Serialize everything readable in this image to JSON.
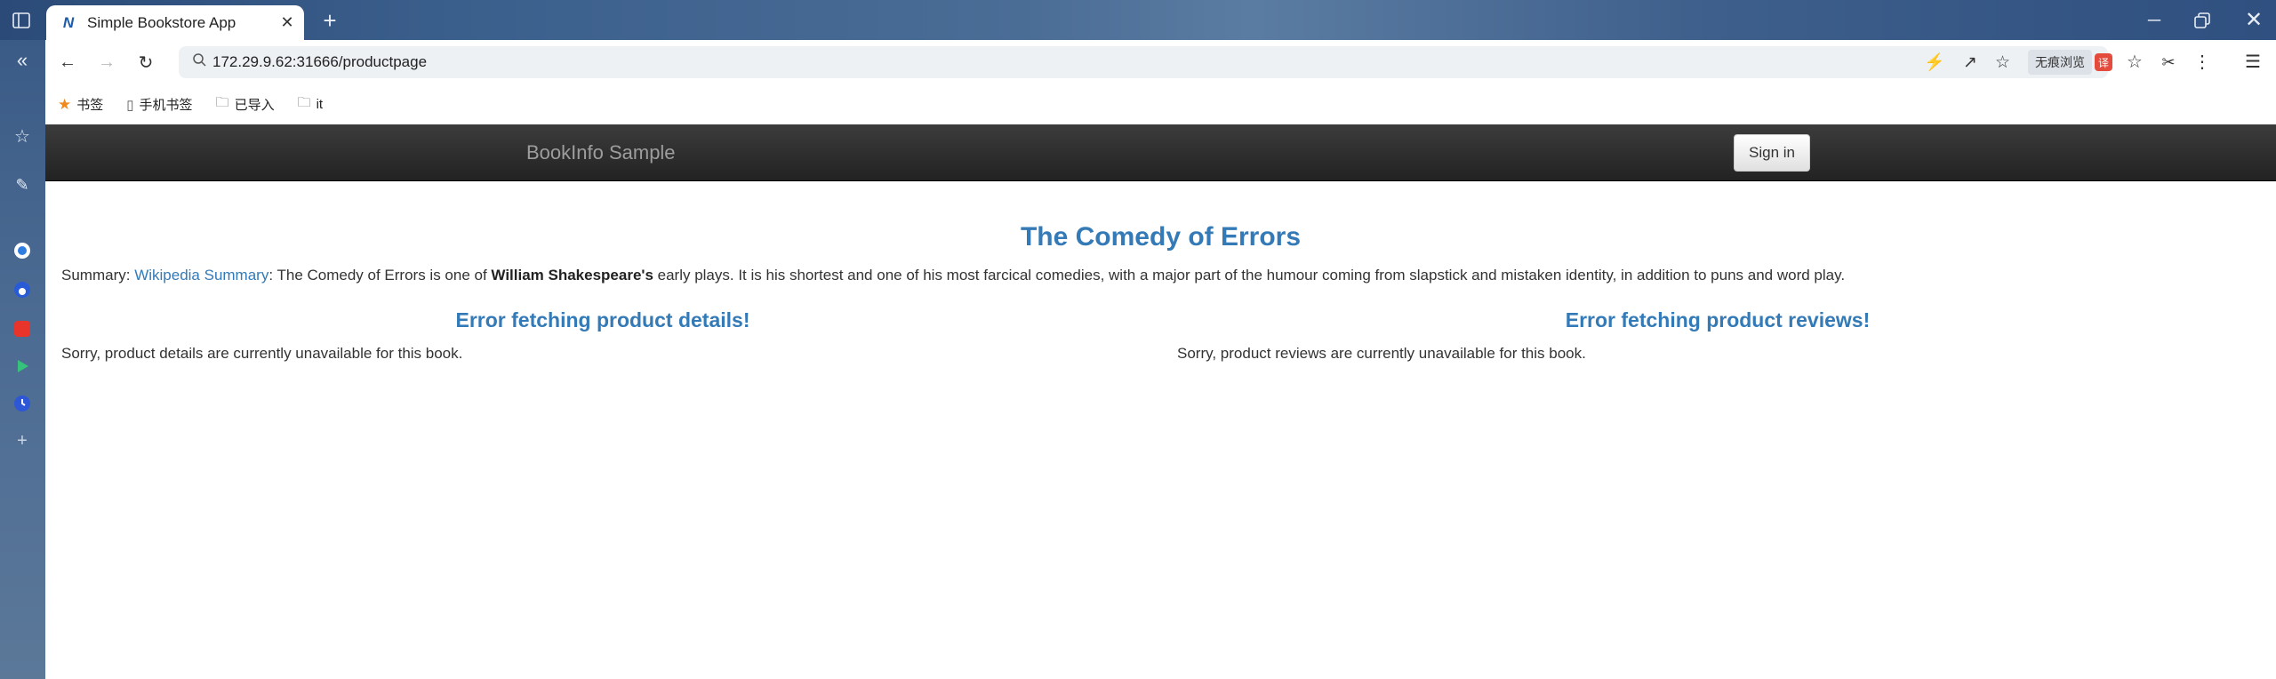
{
  "browser": {
    "tab_title": "Simple Bookstore App",
    "tab_logo": "N",
    "url": "172.29.9.62:31666/productpage",
    "incognito_label": "无痕浏览",
    "extension_label": "译",
    "bookmarks": [
      {
        "label": "书签",
        "icon": "star-icon"
      },
      {
        "label": "手机书签",
        "icon": "phone-icon"
      },
      {
        "label": "已导入",
        "icon": "folder-icon"
      },
      {
        "label": "it",
        "icon": "folder-icon"
      }
    ]
  },
  "page": {
    "brand": "BookInfo Sample",
    "signin_label": "Sign in",
    "title": "The Comedy of Errors",
    "summary": {
      "prefix": "Summary: ",
      "link_text": "Wikipedia Summary",
      "text_a": ": The Comedy of Errors is one of ",
      "bold": "William Shakespeare's",
      "text_b": " early plays. It is his shortest and one of his most farcical comedies, with a major part of the humour coming from slapstick and mistaken identity, in addition to puns and word play."
    },
    "details": {
      "heading": "Error fetching product details!",
      "text": "Sorry, product details are currently unavailable for this book."
    },
    "reviews": {
      "heading": "Error fetching product reviews!",
      "text": "Sorry, product reviews are currently unavailable for this book."
    }
  },
  "colors": {
    "link": "#337ab7",
    "navbar": "#222222",
    "brand": "#9d9d9d"
  }
}
